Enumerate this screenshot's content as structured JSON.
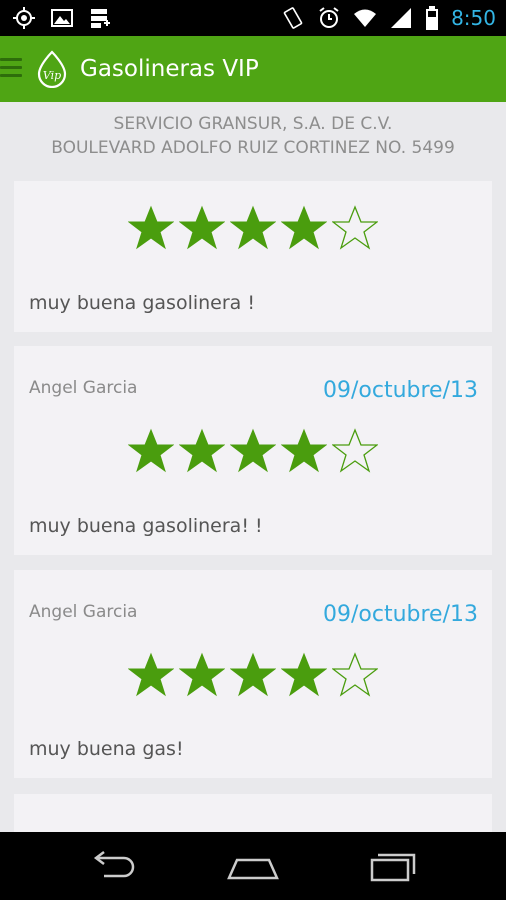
{
  "status_bar": {
    "time": "8:50",
    "left_icons": [
      "gps-icon",
      "image-icon",
      "storage-icon"
    ],
    "right_icons": [
      "rotation-icon",
      "alarm-icon",
      "wifi-icon",
      "signal-icon",
      "battery-icon"
    ]
  },
  "action_bar": {
    "title": "Gasolineras VIP",
    "logo_text": "Vip",
    "color": "#4fa514"
  },
  "station": {
    "name": "SERVICIO GRANSUR, S.A. DE C.V.",
    "address": "BOULEVARD ADOLFO RUIZ CORTINEZ NO. 5499"
  },
  "reviews": [
    {
      "author": "",
      "date": "",
      "rating": 4,
      "max_rating": 5,
      "comment": "muy buena gasolinera !"
    },
    {
      "author": "Angel Garcia",
      "date": "09/octubre/13",
      "rating": 4,
      "max_rating": 5,
      "comment": "muy buena gasolinera! !"
    },
    {
      "author": "Angel Garcia",
      "date": "09/octubre/13",
      "rating": 4,
      "max_rating": 5,
      "comment": "muy buena gas!"
    }
  ],
  "colors": {
    "star": "#4a9d0e",
    "date": "#33a9dd",
    "accent": "#4fa514"
  },
  "nav_bar": {
    "buttons": [
      "back-icon",
      "home-icon",
      "recent-apps-icon"
    ]
  }
}
